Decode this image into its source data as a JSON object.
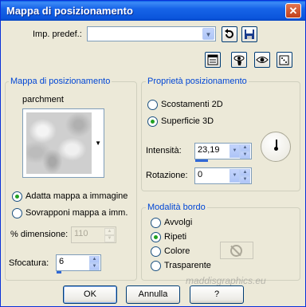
{
  "window": {
    "title": "Mappa di posizionamento",
    "close_symbol": "✕"
  },
  "preset": {
    "label": "Imp. predef.:",
    "value": ""
  },
  "mapping_group": {
    "title": "Mappa di posizionamento",
    "texture_name": "parchment",
    "fit_label": "Adatta mappa a immagine",
    "overlay_label": "Sovrapponi mappa a imm.",
    "size_label": "% dimensione:",
    "size_value": "110",
    "blur_label": "Sfocatura:",
    "blur_value": "6",
    "selected": "fit"
  },
  "properties_group": {
    "title": "Proprietà posizionamento",
    "offsets_label": "Scostamenti 2D",
    "surface_label": "Superficie 3D",
    "selected": "surface",
    "intensity_label": "Intensità:",
    "intensity_value": "23,19",
    "rotation_label": "Rotazione:",
    "rotation_value": "0"
  },
  "edge_group": {
    "title": "Modalità bordo",
    "wrap_label": "Avvolgi",
    "repeat_label": "Ripeti",
    "color_label": "Colore",
    "transparent_label": "Trasparente",
    "selected": "repeat"
  },
  "buttons": {
    "ok": "OK",
    "cancel": "Annulla",
    "help": "?"
  },
  "watermark": "maddisgraphics.eu",
  "icons": {
    "undo": "undo-arrow-icon",
    "save": "save-disk-icon",
    "preview": "preview-window-icon",
    "proof": "eye-hand-icon",
    "auto": "eye-icon",
    "random": "dice-icon"
  },
  "colors": {
    "accent": "#0046d5",
    "title_bar": "#0b55dc",
    "radio_dot": "#21a121"
  }
}
